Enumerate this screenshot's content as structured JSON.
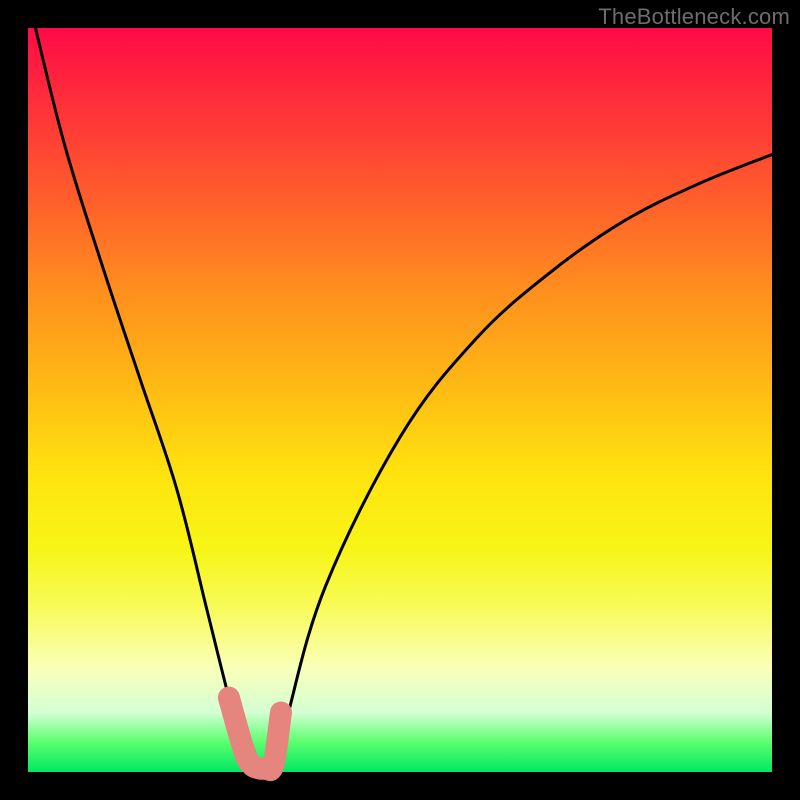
{
  "watermark": "TheBottleneck.com",
  "chart_data": {
    "type": "line",
    "title": "",
    "xlabel": "",
    "ylabel": "",
    "xlim": [
      0,
      100
    ],
    "ylim": [
      0,
      100
    ],
    "grid": false,
    "legend": false,
    "series": [
      {
        "name": "bottleneck-curve",
        "color": "#000000",
        "x": [
          1,
          5,
          10,
          15,
          20,
          24,
          27,
          29,
          30,
          31,
          32,
          33,
          34,
          35,
          40,
          50,
          60,
          70,
          80,
          90,
          100
        ],
        "y": [
          100,
          84,
          68,
          53,
          38,
          22,
          10,
          3,
          1,
          0.5,
          0.5,
          1,
          3,
          8,
          25,
          45,
          58,
          67,
          74,
          79,
          83
        ]
      },
      {
        "name": "highlight-band",
        "color": "#e6847e",
        "x": [
          27,
          29,
          30,
          31,
          32,
          33,
          34
        ],
        "y": [
          10,
          3,
          1,
          0.5,
          0.5,
          1,
          8
        ]
      }
    ],
    "annotations": []
  },
  "colors": {
    "frame": "#000000",
    "curve": "#000000",
    "highlight": "#e6847e",
    "watermark": "#6d6d6d"
  }
}
